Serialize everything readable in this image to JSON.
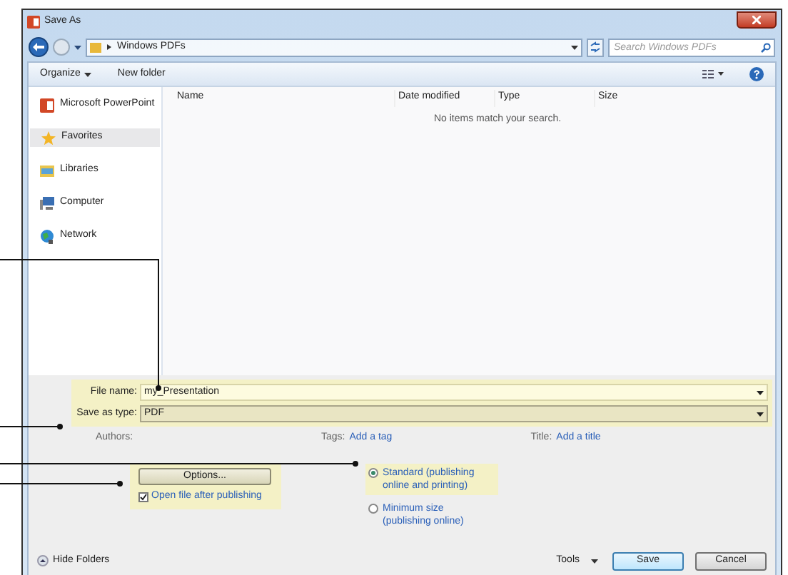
{
  "window": {
    "title": "Save As"
  },
  "address": {
    "location": "Windows PDFs",
    "search_placeholder": "Search Windows PDFs"
  },
  "toolbar": {
    "items": [
      "Organize",
      "New folder"
    ]
  },
  "sidebar": {
    "items": [
      {
        "kind": "app",
        "label": "Microsoft PowerPoint",
        "selected": false
      },
      {
        "kind": "favorites",
        "label": "Favorites",
        "selected": true
      },
      {
        "kind": "libraries",
        "label": "Libraries",
        "selected": false
      },
      {
        "kind": "computer",
        "label": "Computer",
        "selected": false
      },
      {
        "kind": "network",
        "label": "Network",
        "selected": false
      }
    ]
  },
  "table": {
    "columns": [
      "Name",
      "Date modified",
      "Type",
      "Size"
    ],
    "empty_message": "No items match your search."
  },
  "form": {
    "file_name": {
      "label": "File name:",
      "value": "my_Presentation"
    },
    "save_type": {
      "label": "Save as type:",
      "value": "PDF"
    }
  },
  "metadata": {
    "authors_label": "Authors:",
    "tags_label": "Tags:",
    "tags_link": "Add a tag",
    "title_label": "Title:",
    "title_link": "Add a title"
  },
  "options": {
    "button": "Options...",
    "checkbox": {
      "label": "Open file after publishing",
      "checked": true
    }
  },
  "optimize": [
    {
      "label": "Standard (publishing online and printing)",
      "selected": true
    },
    {
      "label": "Minimum size (publishing online)",
      "selected": false
    }
  ],
  "footer": {
    "hide_folders": "Hide Folders",
    "tools": "Tools",
    "save": "Save",
    "cancel": "Cancel"
  }
}
